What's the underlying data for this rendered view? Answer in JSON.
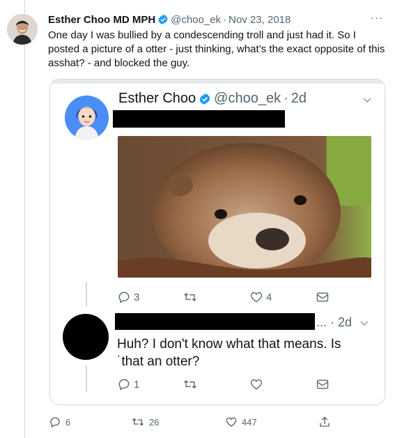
{
  "tweet": {
    "author_name": "Esther Choo MD MPH",
    "handle": "@choo_ek",
    "separator": "·",
    "date": "Nov 23, 2018",
    "more_label": "···",
    "text": "One day I was bullied by a condescending troll and just had it. So I posted a picture of a otter - just thinking, what’s the exact opposite of this asshat? - and blocked the guy."
  },
  "quoted": {
    "author_name": "Esther Choo",
    "handle": "@choo_ek",
    "separator": "·",
    "time": "2d",
    "actions": {
      "replies": "3",
      "likes": "4"
    },
    "reply": {
      "meta": "... · 2d",
      "text": "Huh? I don't know what that means. Is ˙that an otter?",
      "actions": {
        "replies": "1"
      }
    }
  },
  "actions": {
    "replies": "6",
    "retweets": "26",
    "likes": "447"
  },
  "colors": {
    "verified": "#1d9bf0",
    "muted": "#536471",
    "border": "#cfd9de"
  },
  "icons": [
    "verified-badge-icon",
    "more-icon",
    "chevron-down-icon",
    "reply-icon",
    "retweet-icon",
    "like-icon",
    "share-icon",
    "message-icon"
  ]
}
